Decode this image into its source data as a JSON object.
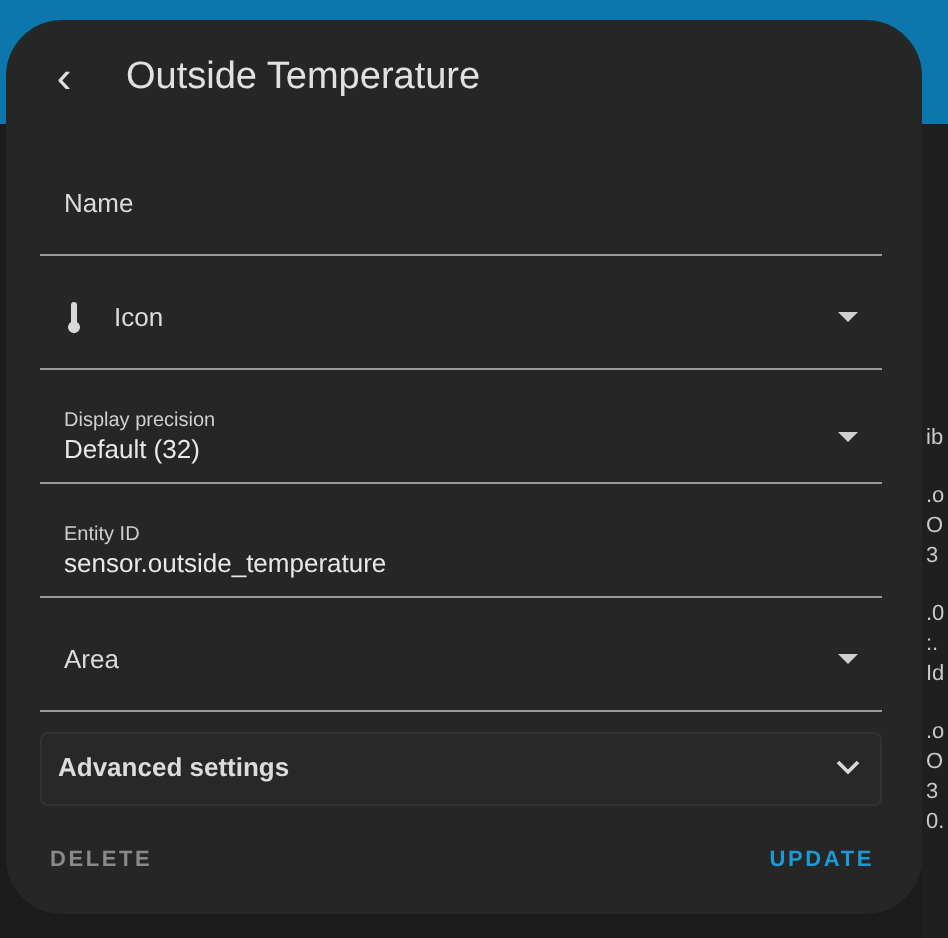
{
  "dialog": {
    "back_icon": "‹",
    "title": "Outside Temperature"
  },
  "fields": [
    {
      "kind": "text",
      "label": "Name"
    },
    {
      "kind": "select",
      "label": "Icon",
      "has_icon": true
    },
    {
      "kind": "select",
      "label": "Display precision",
      "value": "Default (32)"
    },
    {
      "kind": "text",
      "label": "Entity ID",
      "value": "sensor.outside_temperature"
    },
    {
      "kind": "select",
      "label": "Area"
    }
  ],
  "advanced": {
    "label": "Advanced settings",
    "expanded": false
  },
  "buttons": [
    {
      "label": "DELETE",
      "kind": "secondary"
    },
    {
      "label": "UPDATE",
      "kind": "primary"
    }
  ],
  "background": {
    "fragments": [
      "ib",
      ".o",
      "O",
      "3",
      ".0",
      ":.",
      "Id",
      ".o",
      "O",
      "3",
      "0."
    ]
  }
}
